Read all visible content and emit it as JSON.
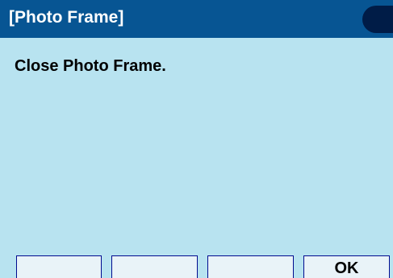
{
  "window": {
    "title": "[Photo Frame]"
  },
  "main": {
    "message": "Close Photo Frame."
  },
  "softkeys": [
    {
      "label": ""
    },
    {
      "label": ""
    },
    {
      "label": ""
    },
    {
      "label": "OK"
    }
  ],
  "colors": {
    "titlebar": "#075593",
    "title_text": "#ffffff",
    "status_indicator": "#001c47",
    "content_background": "#b8e3f0",
    "softkey_background": "#e9f3f8",
    "softkey_border": "#000b8f"
  }
}
